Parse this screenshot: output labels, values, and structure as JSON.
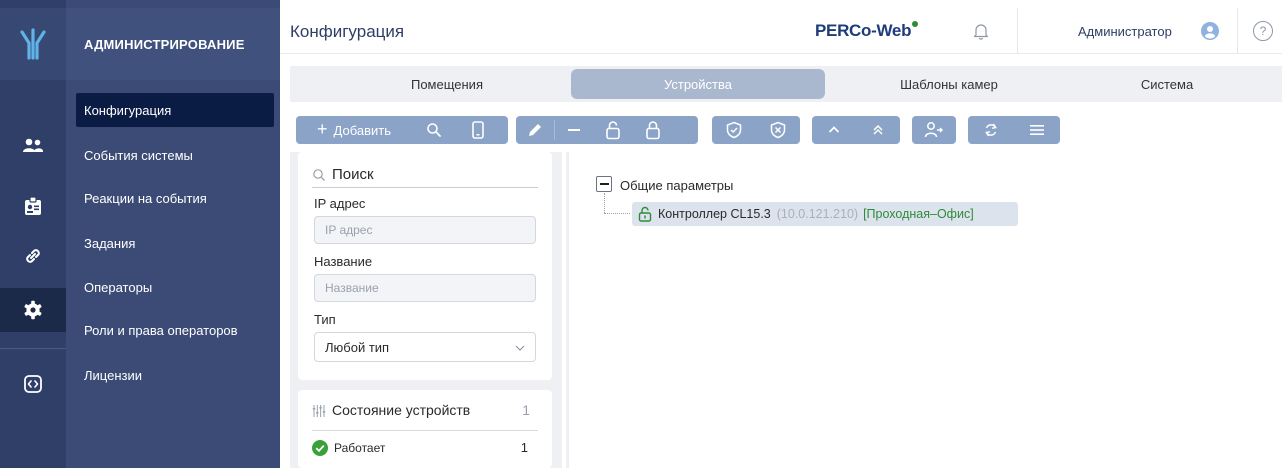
{
  "sidebar": {
    "section_title": "АДМИНИСТРИРОВАНИЕ",
    "items": [
      {
        "label": "Конфигурация"
      },
      {
        "label": "События системы"
      },
      {
        "label": "Реакции на события"
      },
      {
        "label": "Задания"
      },
      {
        "label": "Операторы"
      },
      {
        "label": "Роли и права операторов"
      },
      {
        "label": "Лицензии"
      }
    ],
    "active_index": 0
  },
  "rail": {
    "icons": [
      "users-icon",
      "badge-icon",
      "link-icon",
      "gear-icon",
      "code-icon"
    ],
    "active_icon": "gear-icon"
  },
  "header": {
    "title": "Конфигурация",
    "brand": "PERCo-Web",
    "user": "Администратор",
    "help_glyph": "?"
  },
  "tabs": [
    {
      "label": "Помещения"
    },
    {
      "label": "Устройства"
    },
    {
      "label": "Шаблоны камер"
    },
    {
      "label": "Система"
    }
  ],
  "active_tab": 1,
  "toolbar": {
    "add_label": "Добавить"
  },
  "filter": {
    "search_label": "Поиск",
    "ip_label": "IP адрес",
    "ip_placeholder": "IP адрес",
    "name_label": "Название",
    "name_placeholder": "Название",
    "type_label": "Тип",
    "type_value": "Любой тип"
  },
  "device_status": {
    "title": "Состояние устройств",
    "total": "1",
    "items": [
      {
        "label": "Работает",
        "count": "1"
      }
    ]
  },
  "tree": {
    "root_label": "Общие параметры",
    "nodes": [
      {
        "name": "Контроллер CL15.3",
        "ip": "(10.0.121.210)",
        "location": "[Проходная–Офис]"
      }
    ]
  },
  "colors": {
    "rail": "#2f3f67",
    "nav": "#3b4b75",
    "nav_active": "#0b1c44",
    "toolbar_button": "#8aa3c7",
    "tab_active": "#aab8cf",
    "status_ok": "#3aa13a",
    "location_text": "#2f8a3b"
  }
}
